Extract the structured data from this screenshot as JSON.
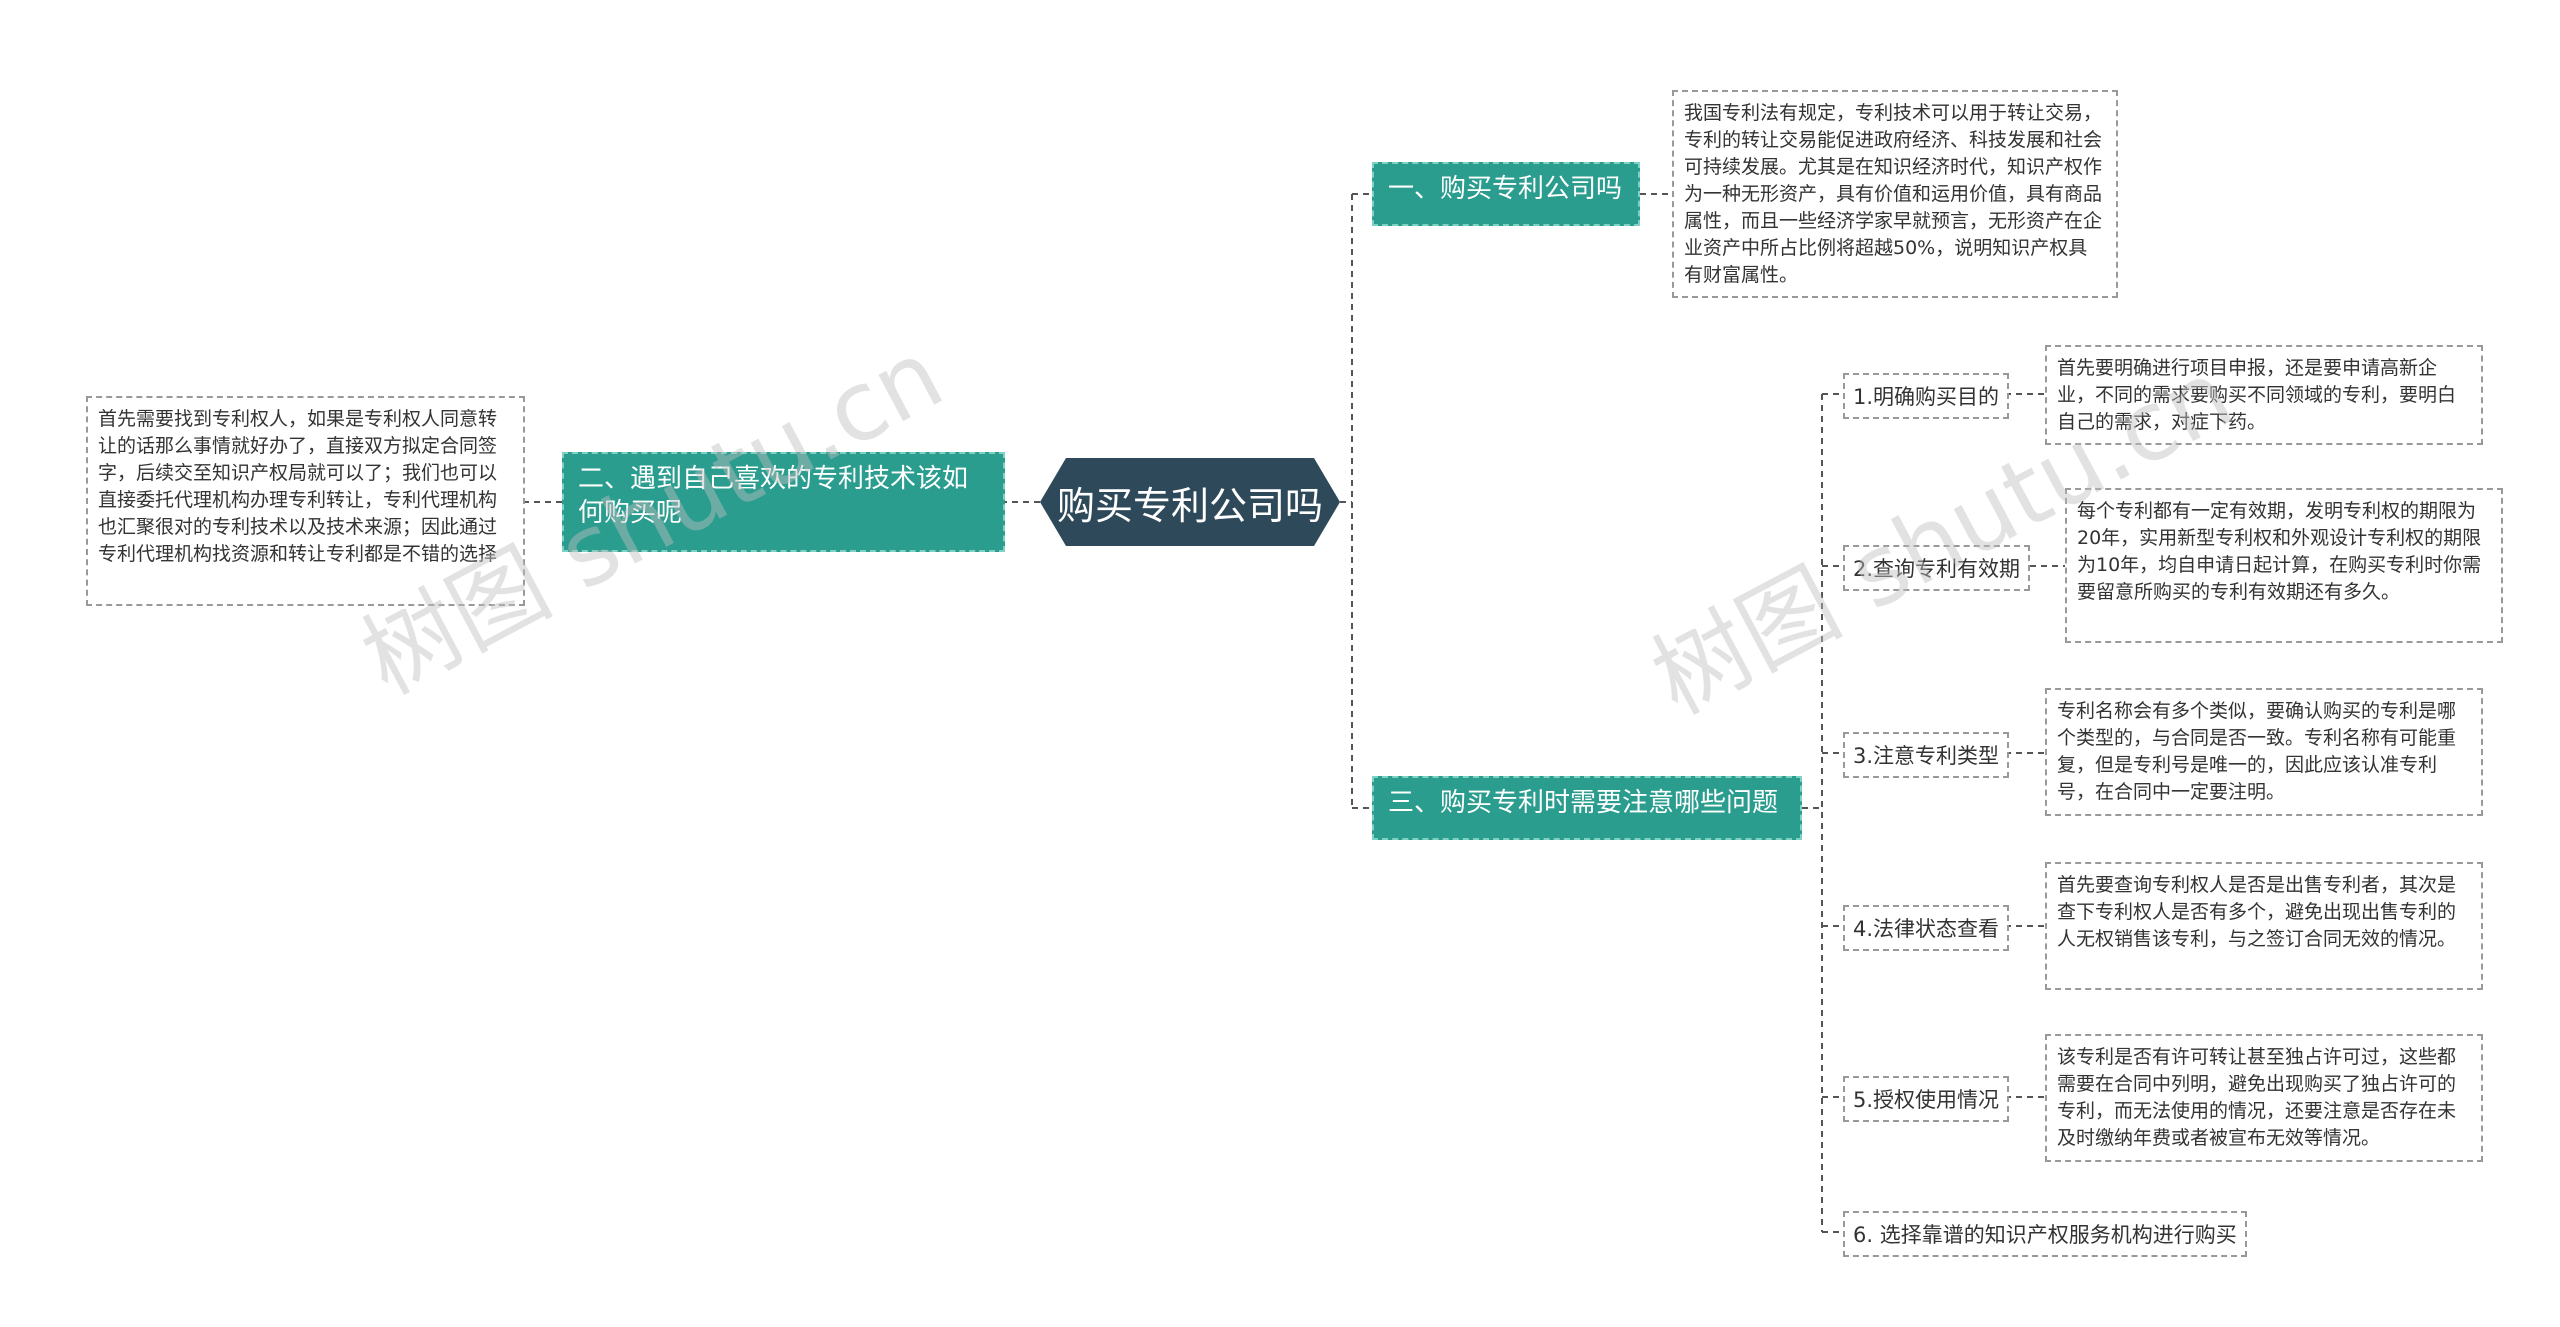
{
  "root": {
    "label": "购买专利公司吗"
  },
  "branches": {
    "b1": {
      "label": "一、购买专利公司吗",
      "detail": "我国专利法有规定，专利技术可以用于转让交易，专利的转让交易能促进政府经济、科技发展和社会可持续发展。尤其是在知识经济时代，知识产权作为一种无形资产，具有价值和运用价值，具有商品属性，而且一些经济学家早就预言，无形资产在企业资产中所占比例将超越50%，说明知识产权具有财富属性。"
    },
    "b2": {
      "label": "二、遇到自己喜欢的专利技术该如何购买呢",
      "detail": "首先需要找到专利权人，如果是专利权人同意转让的话那么事情就好办了，直接双方拟定合同签字，后续交至知识产权局就可以了；我们也可以直接委托代理机构办理专利转让，专利代理机构也汇聚很对的专利技术以及技术来源；因此通过专利代理机构找资源和转让专利都是不错的选择"
    },
    "b3": {
      "label": "三、购买专利时需要注意哪些问题",
      "items": [
        {
          "label": "1.明确购买目的",
          "detail": "首先要明确进行项目申报，还是要申请高新企业，不同的需求要购买不同领域的专利，要明白自己的需求，对症下药。"
        },
        {
          "label": "2.查询专利有效期",
          "detail": "每个专利都有一定有效期，发明专利权的期限为20年，实用新型专利权和外观设计专利权的期限为10年，均自申请日起计算，在购买专利时你需要留意所购买的专利有效期还有多久。"
        },
        {
          "label": "3.注意专利类型",
          "detail": "专利名称会有多个类似，要确认购买的专利是哪个类型的，与合同是否一致。专利名称有可能重复，但是专利号是唯一的，因此应该认准专利号，在合同中一定要注明。"
        },
        {
          "label": "4.法律状态查看",
          "detail": "首先要查询专利权人是否是出售专利者，其次是查下专利权人是否有多个，避免出现出售专利的人无权销售该专利，与之签订合同无效的情况。"
        },
        {
          "label": "5.授权使用情况",
          "detail": "该专利是否有许可转让甚至独占许可过，这些都需要在合同中列明，避免出现购买了独占许可的专利，而无法使用的情况，还要注意是否存在未及时缴纳年费或者被宣布无效等情况。"
        },
        {
          "label": "6. 选择靠谱的知识产权服务机构进行购买"
        }
      ]
    }
  },
  "watermarks": [
    "树图 shutu.cn",
    "树图 shutu.cn"
  ]
}
